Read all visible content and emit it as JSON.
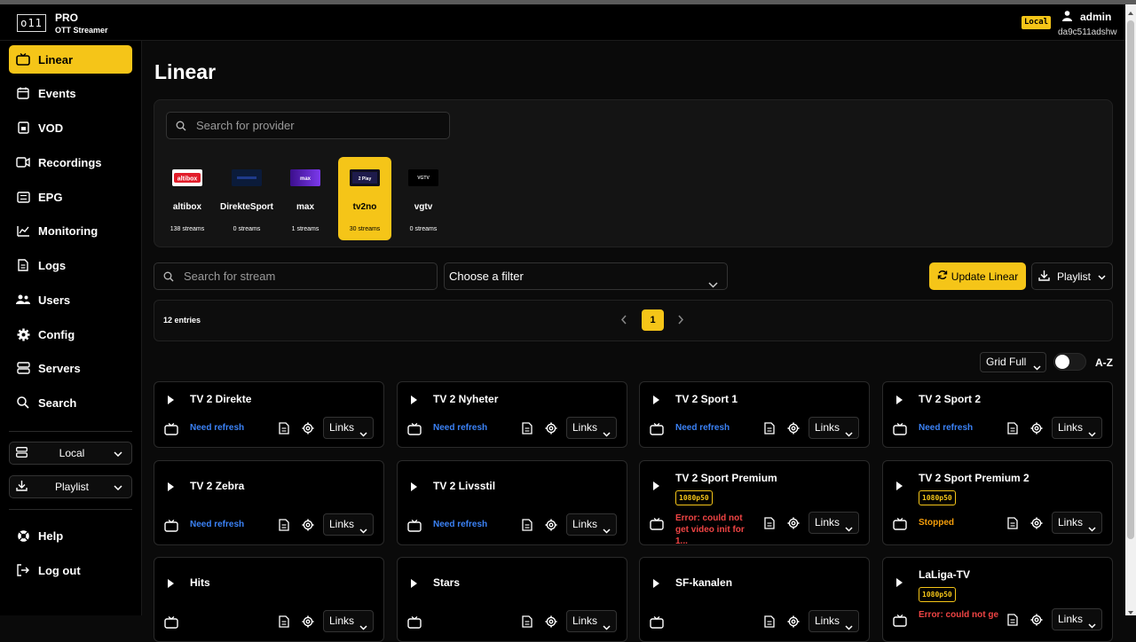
{
  "header": {
    "logo_text": "o11",
    "logo_title": "PRO",
    "logo_subtitle": "OTT Streamer",
    "server_badge": "Local",
    "user_name": "admin",
    "user_id": "da9c511adshw"
  },
  "sidebar": {
    "items": [
      {
        "label": "Linear",
        "icon": "tv-icon",
        "active": true
      },
      {
        "label": "Events",
        "icon": "calendar-icon"
      },
      {
        "label": "VOD",
        "icon": "film-icon"
      },
      {
        "label": "Recordings",
        "icon": "video-camera-icon"
      },
      {
        "label": "EPG",
        "icon": "guide-icon"
      },
      {
        "label": "Monitoring",
        "icon": "chart-icon"
      },
      {
        "label": "Logs",
        "icon": "document-icon"
      },
      {
        "label": "Users",
        "icon": "users-icon"
      },
      {
        "label": "Config",
        "icon": "gear-icon"
      },
      {
        "label": "Servers",
        "icon": "server-icon"
      },
      {
        "label": "Search",
        "icon": "search-icon"
      }
    ],
    "server_select": "Local",
    "playlist_select": "Playlist",
    "help_label": "Help",
    "logout_label": "Log out"
  },
  "main": {
    "title": "Linear",
    "provider_search_placeholder": "Search for provider",
    "providers": [
      {
        "name": "altibox",
        "count": "138 streams",
        "logo_color": "#e11d2a",
        "logo_text": "altibox"
      },
      {
        "name": "DirekteSport",
        "count": "0 streams",
        "logo_color": "#0b1b3a",
        "logo_text": ""
      },
      {
        "name": "max",
        "count": "1 streams",
        "logo_color": "#5b21b6",
        "logo_text": "max"
      },
      {
        "name": "tv2no",
        "count": "30 streams",
        "logo_color": "#111827",
        "logo_text": "2 Play",
        "selected": true
      },
      {
        "name": "vgtv",
        "count": "0 streams",
        "logo_color": "#000000",
        "logo_text": "VGTV"
      }
    ],
    "stream_search_placeholder": "Search for stream",
    "filter_placeholder": "Choose a filter",
    "update_button": "Update Linear",
    "playlist_button": "Playlist",
    "entries_text": "12 entries",
    "current_page": "1",
    "view_select": "Grid Full",
    "sort_label": "A-Z",
    "links_label": "Links",
    "streams": [
      {
        "name": "TV 2 Direkte",
        "status": "Need refresh",
        "status_type": "refresh"
      },
      {
        "name": "TV 2 Nyheter",
        "status": "Need refresh",
        "status_type": "refresh"
      },
      {
        "name": "TV 2 Sport 1",
        "status": "Need refresh",
        "status_type": "refresh"
      },
      {
        "name": "TV 2 Sport 2",
        "status": "Need refresh",
        "status_type": "refresh"
      },
      {
        "name": "TV 2 Zebra",
        "status": "Need refresh",
        "status_type": "refresh"
      },
      {
        "name": "TV 2 Livsstil",
        "status": "Need refresh",
        "status_type": "refresh"
      },
      {
        "name": "TV 2 Sport Premium",
        "badge": "1080p50",
        "status": "Error: could not get video init for 1...",
        "status_type": "error"
      },
      {
        "name": "TV 2 Sport Premium 2",
        "badge": "1080p50",
        "status": "Stopped",
        "status_type": "stopped"
      },
      {
        "name": "Hits"
      },
      {
        "name": "Stars"
      },
      {
        "name": "SF-kanalen"
      },
      {
        "name": "LaLiga-TV",
        "badge": "1080p50",
        "status": "Error: could not ge",
        "status_type": "error"
      }
    ]
  },
  "colors": {
    "accent": "#f5c518",
    "refresh": "#3b82f6",
    "error": "#ef4444",
    "stopped": "#f59e0b"
  }
}
